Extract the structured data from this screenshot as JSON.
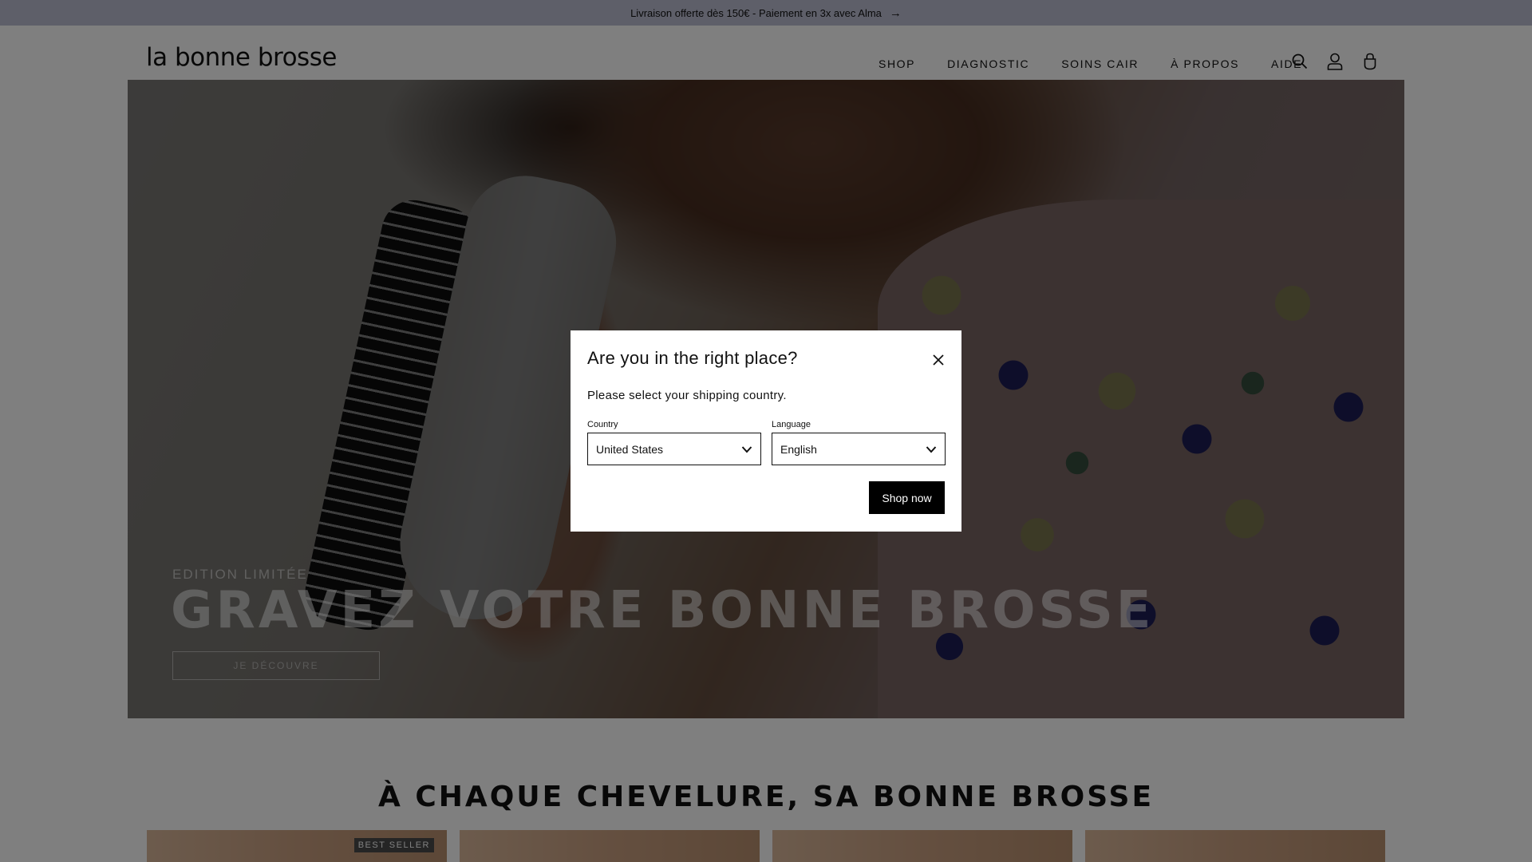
{
  "announcement": {
    "text": "Livraison offerte dès 150€ - Paiement en 3x avec Alma",
    "arrow_icon": "arrow-right-icon"
  },
  "header": {
    "logo": "la bonne brosse",
    "nav": [
      "SHOP",
      "DIAGNOSTIC",
      "SOINS CAIR",
      "À PROPOS",
      "AIDE"
    ],
    "icons": [
      "search-icon",
      "account-icon",
      "cart-icon"
    ]
  },
  "hero": {
    "kicker": "EDITION LIMITÉE",
    "title": "GRAVEZ VOTRE BONNE BROSSE",
    "button": "JE DÉCOUVRE"
  },
  "section": {
    "title": "À CHAQUE CHEVELURE, SA BONNE BROSSE"
  },
  "cards": [
    {
      "badge": "BEST SELLER"
    },
    {
      "badge": ""
    },
    {
      "badge": ""
    },
    {
      "badge": ""
    }
  ],
  "modal": {
    "title": "Are you in the right place?",
    "subtitle": "Please select your shipping country.",
    "country_label": "Country",
    "country_value": "United States",
    "language_label": "Language",
    "language_value": "English",
    "button": "Shop now"
  },
  "colors": {
    "announcement_bg": "#bcbfd3",
    "button_bg": "#000000",
    "overlay": "rgba(0,0,0,0.5)"
  }
}
